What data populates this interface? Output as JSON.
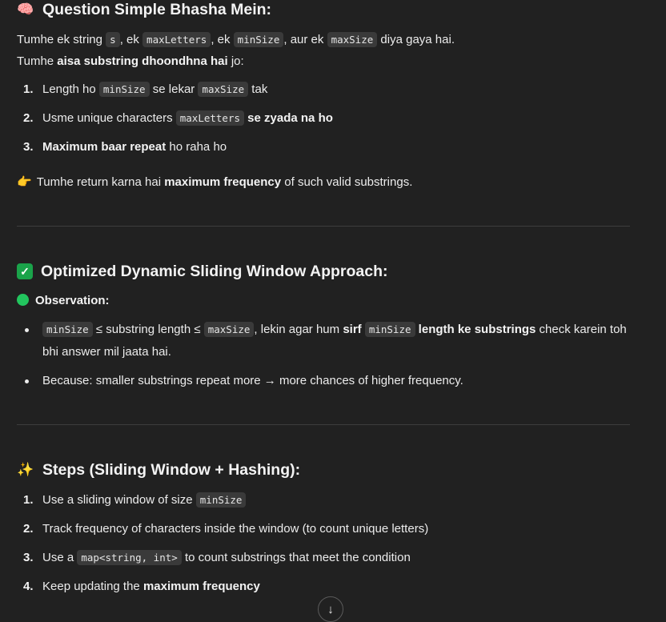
{
  "section1": {
    "icon": "brain-icon",
    "title": "Question Simple Bhasha Mein:",
    "line1": {
      "t1": "Tumhe ek string ",
      "c1": "s",
      "t2": ", ek ",
      "c2": "maxLetters",
      "t3": ", ek ",
      "c3": "minSize",
      "t4": ", aur ek ",
      "c4": "maxSize",
      "t5": " diya gaya hai."
    },
    "line2": {
      "t1": "Tumhe ",
      "b1": "aisa substring dhoondhna hai",
      "t2": " jo:"
    },
    "items": [
      {
        "num": "1.",
        "t1": "Length ho ",
        "c1": "minSize",
        "t2": " se lekar ",
        "c2": "maxSize",
        "t3": " tak"
      },
      {
        "num": "2.",
        "t1": "Usme unique characters ",
        "c1": "maxLetters",
        "b1": " se zyada na ho"
      },
      {
        "num": "3.",
        "b1": "Maximum baar repeat",
        "t1": " ho raha ho"
      }
    ],
    "note": {
      "icon": "pointing-hand-icon",
      "t1": "Tumhe return karna hai ",
      "b1": "maximum frequency",
      "t2": " of such valid substrings."
    }
  },
  "section2": {
    "icon": "check-box-icon",
    "title": "Optimized Dynamic Sliding Window Approach:",
    "observation": "Observation:",
    "bullets": [
      {
        "c1": "minSize",
        "t1": " ≤ substring length ≤ ",
        "c2": "maxSize",
        "t2": ", lekin agar hum ",
        "b1": "sirf ",
        "c3": "minSize",
        "b2": " length ke substrings",
        "t3": " check karein toh bhi answer mil jaata hai."
      },
      {
        "t1": "Because: smaller substrings repeat more → more chances of higher frequency."
      }
    ]
  },
  "section3": {
    "icon": "sparkles-icon",
    "title": "Steps (Sliding Window + Hashing):",
    "items": [
      {
        "num": "1.",
        "t1": "Use a sliding window of size ",
        "c1": "minSize"
      },
      {
        "num": "2.",
        "t1": "Track frequency of characters inside the window (to count unique letters)"
      },
      {
        "num": "3.",
        "t1": "Use a ",
        "c1": "map<string, int>",
        "t2": " to count substrings that meet the condition"
      },
      {
        "num": "4.",
        "t1": "Keep updating the ",
        "b1": "maximum frequency"
      }
    ]
  },
  "scroll_button": {
    "icon": "arrow-down-icon",
    "glyph": "↓"
  },
  "colors": {
    "background": "#212121",
    "text": "#ececec",
    "code_bg": "#3a3a3a",
    "check_green": "#1aa34a",
    "dot_green": "#22c55e"
  }
}
